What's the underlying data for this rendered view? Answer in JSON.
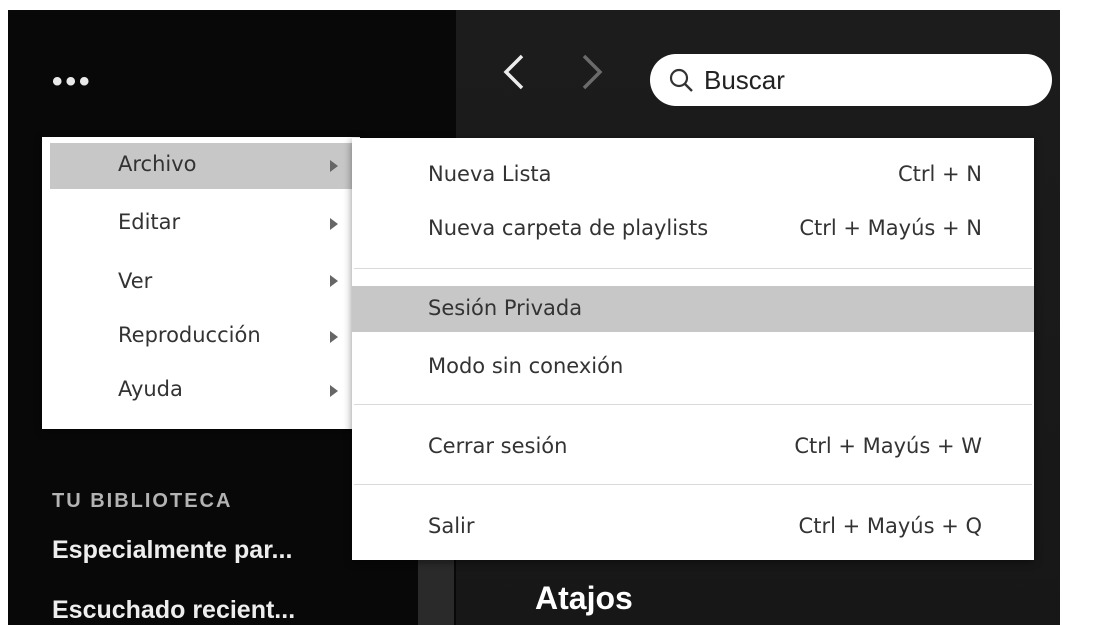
{
  "search": {
    "placeholder": "Buscar"
  },
  "menu": {
    "items": [
      {
        "label": "Archivo"
      },
      {
        "label": "Editar"
      },
      {
        "label": "Ver"
      },
      {
        "label": "Reproducción"
      },
      {
        "label": "Ayuda"
      }
    ]
  },
  "submenu": {
    "items": [
      {
        "label": "Nueva Lista",
        "shortcut": "Ctrl + N"
      },
      {
        "label": "Nueva carpeta de playlists",
        "shortcut": "Ctrl + Mayús + N"
      },
      {
        "label": "Sesión Privada",
        "shortcut": ""
      },
      {
        "label": "Modo sin conexión",
        "shortcut": ""
      },
      {
        "label": "Cerrar sesión",
        "shortcut": "Ctrl + Mayús + W"
      },
      {
        "label": "Salir",
        "shortcut": "Ctrl + Mayús + Q"
      }
    ]
  },
  "library": {
    "heading": "TU BIBLIOTECA",
    "items": [
      {
        "label": "Especialmente par..."
      },
      {
        "label": "Escuchado recient..."
      }
    ]
  },
  "main": {
    "section_title": "Atajos"
  },
  "colors": {
    "sidebar_bg": "#080808",
    "main_bg": "#1c1c1c",
    "menu_bg": "#ffffff",
    "menu_highlight": "#c7c7c7"
  }
}
